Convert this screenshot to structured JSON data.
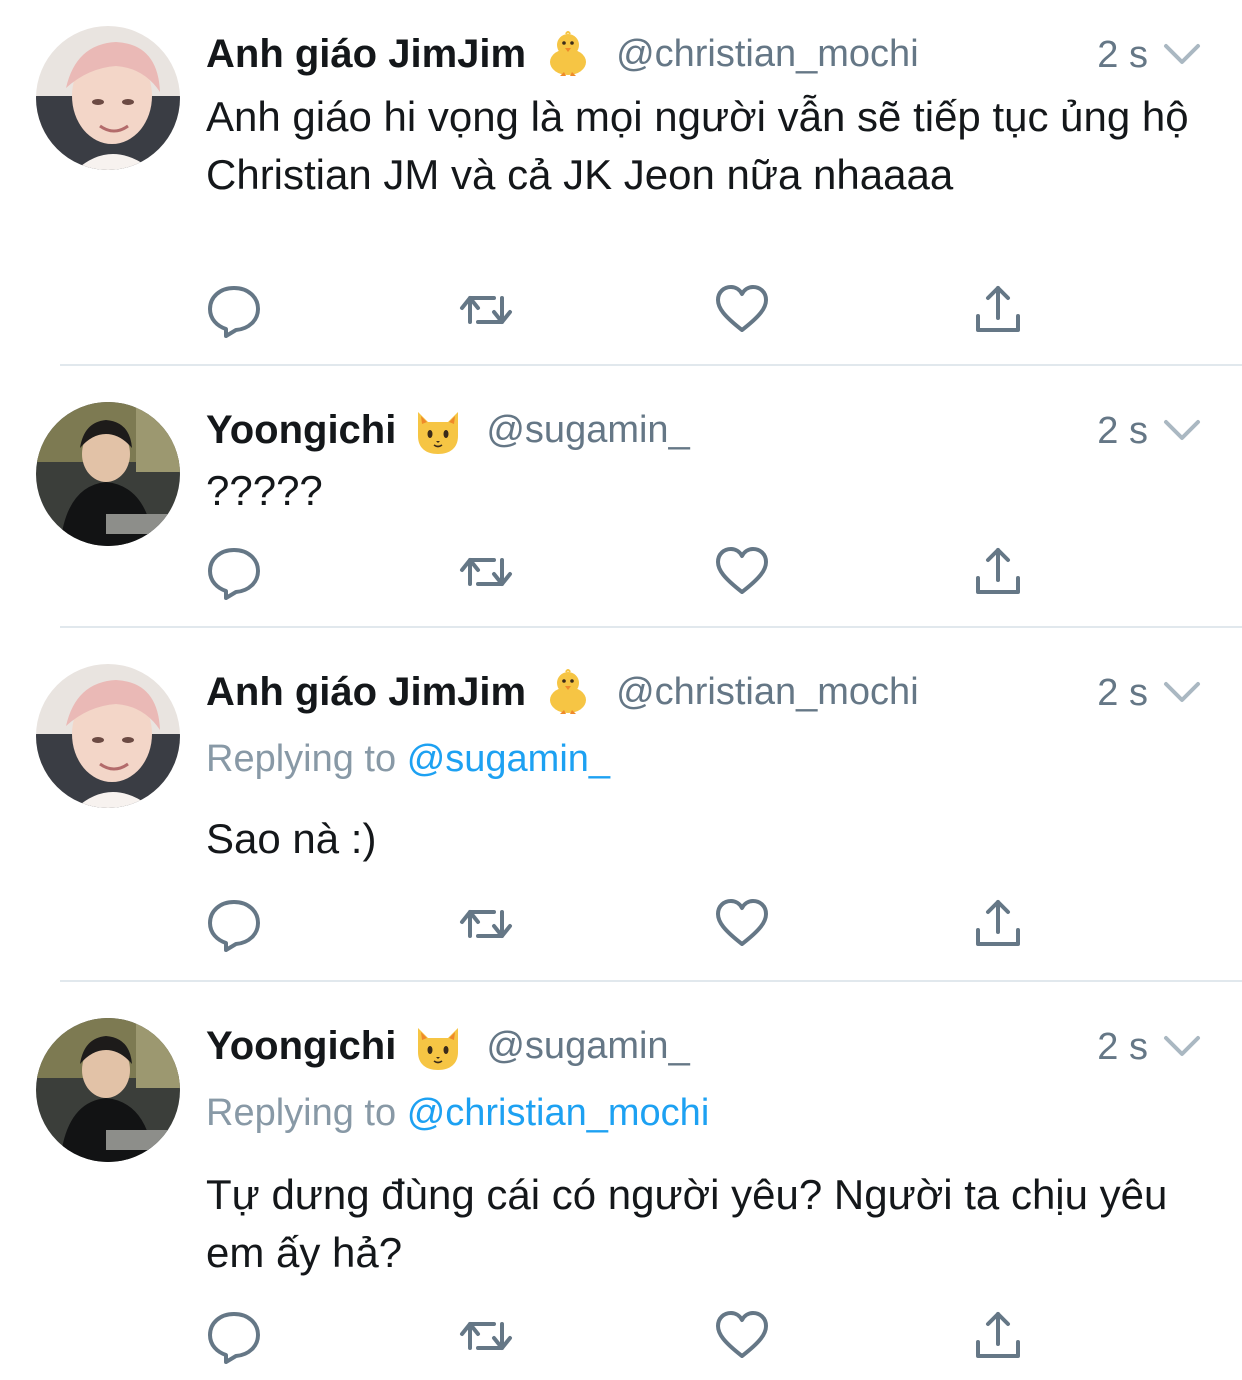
{
  "tweets": [
    {
      "name": "Anh giáo JimJim",
      "emoji": "chick-emoji",
      "handle": "@christian_mochi",
      "time": "2 s",
      "replying_label": "",
      "replying_to": "",
      "text": "Anh giáo hi vọng là mọi người vẫn sẽ tiếp tục ủng hộ Christian JM và cả JK Jeon nữa nhaaaa"
    },
    {
      "name": "Yoongichi",
      "emoji": "cat-emoji",
      "handle": "@sugamin_",
      "time": "2 s",
      "replying_label": "",
      "replying_to": "",
      "text": "?????"
    },
    {
      "name": "Anh giáo JimJim",
      "emoji": "chick-emoji",
      "handle": "@christian_mochi",
      "time": "2 s",
      "replying_label": "Replying to",
      "replying_to": "@sugamin_",
      "text": "Sao nà :)"
    },
    {
      "name": "Yoongichi",
      "emoji": "cat-emoji",
      "handle": "@sugamin_",
      "time": "2 s",
      "replying_label": "Replying to",
      "replying_to": "@christian_mochi",
      "text": "Tự dưng đùng cái có người yêu? Người ta chịu yêu em ấy hả?"
    }
  ],
  "colors": {
    "text": "#14171a",
    "secondary": "#657786",
    "link": "#1da1f2",
    "icon": "#657786",
    "divider": "#e1e8ed"
  },
  "icons": [
    "reply-icon",
    "retweet-icon",
    "like-icon",
    "share-icon",
    "chevron-down-icon"
  ]
}
